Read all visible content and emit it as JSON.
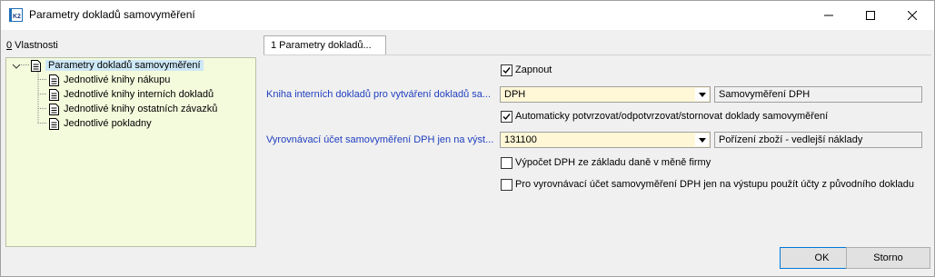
{
  "window": {
    "title": "Parametry dokladů samovyměření",
    "icon": "k2-app-icon"
  },
  "left_panel": {
    "label_prefix": "0",
    "label": " Vlastnosti",
    "tree": {
      "root": "Parametry dokladů samovyměření",
      "children": [
        "Jednotlivé knihy nákupu",
        "Jednotlivé knihy interních dokladů",
        "Jednotlivé knihy ostatních závazků",
        "Jednotlivé pokladny"
      ]
    }
  },
  "tabs": [
    {
      "label": "1 Parametry dokladů..."
    }
  ],
  "form": {
    "zapnout": {
      "label": "Zapnout",
      "checked": true
    },
    "kniha": {
      "label": "Kniha interních dokladů pro vytváření dokladů sa...",
      "value": "DPH",
      "description": "Samovyměření DPH"
    },
    "auto": {
      "label": "Automaticky potvrzovat/odpotvrzovat/stornovat doklady samovyměření",
      "checked": true
    },
    "ucet": {
      "label": "Vyrovnávací účet samovyměření DPH jen na výst...",
      "value": "131100",
      "description": "Pořízení zboží - vedlejší náklady"
    },
    "vypocet": {
      "label": "Výpočet DPH ze základu daně v měně firmy",
      "checked": false
    },
    "puvodni": {
      "label": "Pro vyrovnávací účet samovyměření DPH jen na výstupu použít účty z původního dokladu",
      "checked": false
    }
  },
  "buttons": {
    "ok": "OK",
    "storno": "Storno"
  }
}
